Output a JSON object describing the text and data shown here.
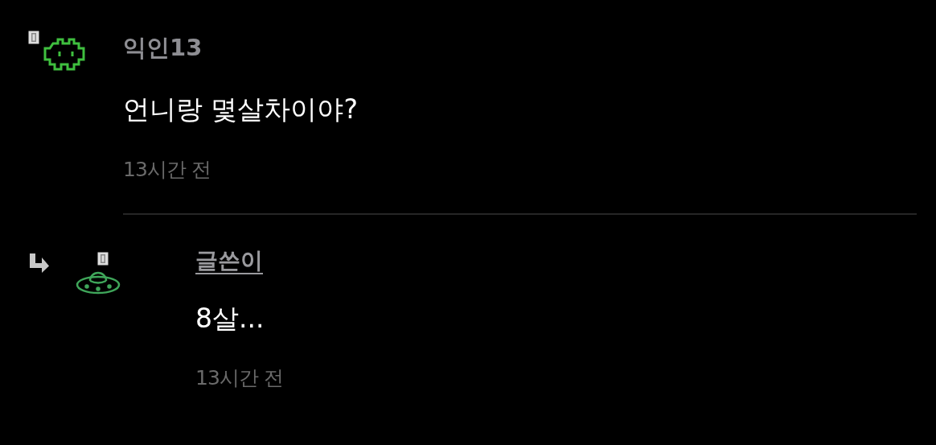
{
  "comment": {
    "author": "익인13",
    "text": "언니랑 몇살차이야?",
    "time": "13시간 전"
  },
  "reply": {
    "author": "글쓴이",
    "text": "8살...",
    "time": "13시간 전"
  }
}
